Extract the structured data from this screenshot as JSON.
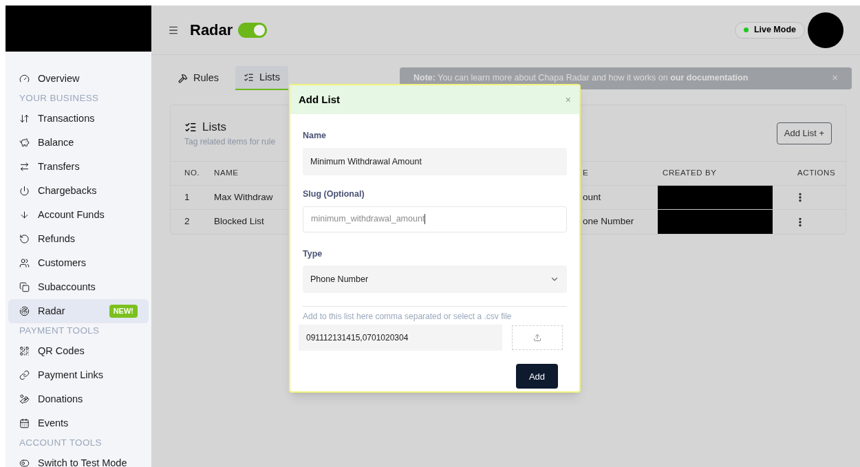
{
  "header": {
    "title": "Radar",
    "toggle_on": true,
    "live_badge": "Live Mode"
  },
  "sidebar": {
    "items": [
      {
        "kind": "link",
        "label": "Overview",
        "selected": false
      },
      {
        "kind": "heading",
        "label": "YOUR BUSINESS"
      },
      {
        "kind": "link",
        "label": "Transactions",
        "selected": false
      },
      {
        "kind": "link",
        "label": "Balance",
        "selected": false
      },
      {
        "kind": "link",
        "label": "Transfers",
        "selected": false
      },
      {
        "kind": "link",
        "label": "Chargebacks",
        "selected": false
      },
      {
        "kind": "link",
        "label": "Account Funds",
        "selected": false
      },
      {
        "kind": "link",
        "label": "Refunds",
        "selected": false
      },
      {
        "kind": "link",
        "label": "Customers",
        "selected": false
      },
      {
        "kind": "link",
        "label": "Subaccounts",
        "selected": false
      },
      {
        "kind": "link",
        "label": "Radar",
        "selected": true,
        "badge": "NEW!"
      },
      {
        "kind": "heading",
        "label": "PAYMENT TOOLS"
      },
      {
        "kind": "link",
        "label": "QR Codes",
        "selected": false
      },
      {
        "kind": "link",
        "label": "Payment Links",
        "selected": false
      },
      {
        "kind": "link",
        "label": "Donations",
        "selected": false
      },
      {
        "kind": "link",
        "label": "Events",
        "selected": false
      },
      {
        "kind": "heading",
        "label": "ACCOUNT TOOLS"
      },
      {
        "kind": "link",
        "label": "Switch to Test Mode",
        "selected": false
      }
    ]
  },
  "tabs": [
    {
      "label": "Rules",
      "selected": false
    },
    {
      "label": "Lists",
      "selected": true
    }
  ],
  "note": {
    "text": "**Note:** You can learn more about Chapa Radar and how it works on **our documentation**",
    "close": "×"
  },
  "card": {
    "title": "Lists",
    "subtitle": "Tag related items for rule",
    "add_button": "Add List +"
  },
  "table": {
    "columns": [
      "NO.",
      "NAME",
      "E",
      "CREATED BY",
      "ACTIONS"
    ],
    "rows": [
      {
        "no": "1",
        "name": "Max Withdraw",
        "column_3": "ount"
      },
      {
        "no": "2",
        "name": "Blocked List",
        "column_3": "one Number"
      }
    ]
  },
  "modal": {
    "title": "Add List",
    "close": "×",
    "name": {
      "label": "Name",
      "value": "Minimum Withdrawal Amount"
    },
    "slug": {
      "label": "Slug (Optional)",
      "value": "minimum_withdrawal_amount",
      "focused": true
    },
    "type": {
      "label": "Type",
      "value": "Phone Number"
    },
    "entries": {
      "hint": "Add to this list here comma separated or select a .csv file",
      "value": "091112131415,0701020304"
    },
    "submit": "Add"
  }
}
